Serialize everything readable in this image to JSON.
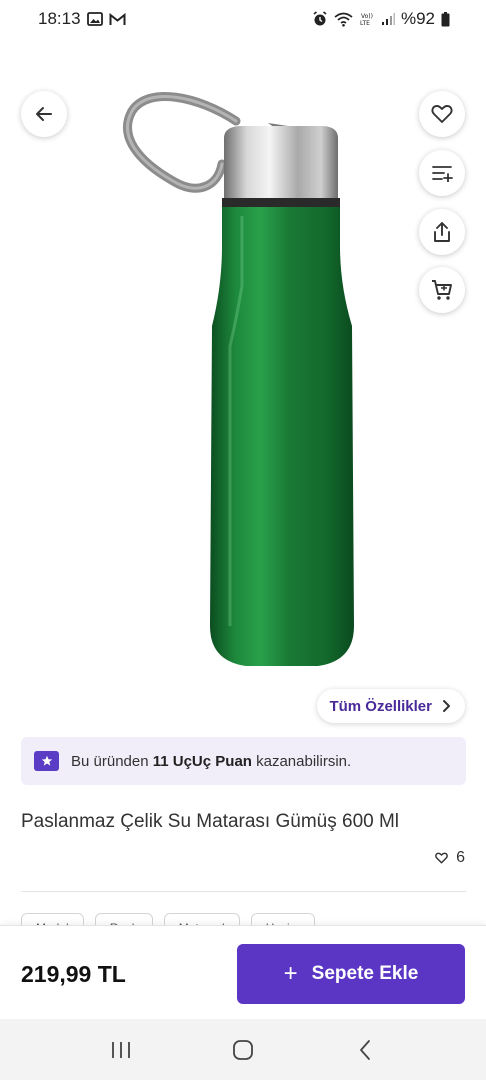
{
  "status_bar": {
    "time": "18:13",
    "battery": "%92",
    "icons": [
      "gallery-icon",
      "gmail-icon",
      "alarm-icon",
      "wifi-icon",
      "volte-icon",
      "signal-icon",
      "battery-icon"
    ]
  },
  "image_actions": {
    "icons": [
      "back-arrow-icon",
      "heart-icon",
      "add-to-list-icon",
      "share-icon",
      "cart-icon"
    ]
  },
  "all_features_label": "Tüm Özellikler",
  "points_banner": {
    "prefix": "Bu üründen ",
    "points": "11 UçUç Puan",
    "suffix": " kazanabilirsin."
  },
  "product": {
    "title": "Paslanmaz Çelik Su Matarası Gümüş 600 Ml",
    "likes": "6",
    "price": "219,99 TL"
  },
  "chips": [
    "Model",
    "Renk",
    "Materyal",
    "Hacim"
  ],
  "add_to_cart_label": "Sepete Ekle",
  "colors": {
    "accent": "#5b36c4",
    "banner_bg": "#f1eefa",
    "bottle": "#1b7a36"
  }
}
